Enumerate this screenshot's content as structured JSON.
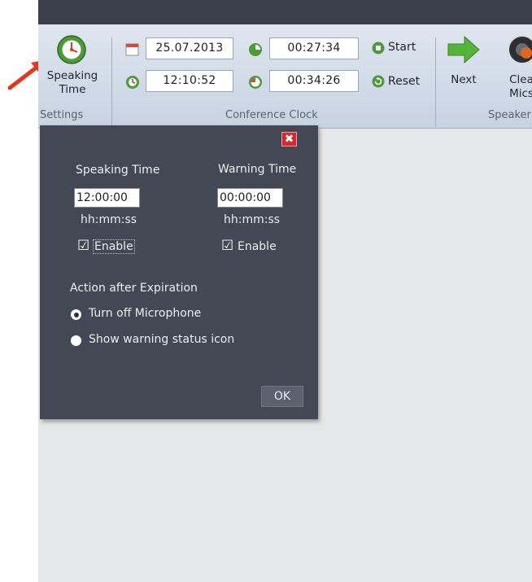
{
  "settings_group": {
    "speaking_time_label_line1": "Speaking",
    "speaking_time_label_line2": "Time",
    "group_label": "Settings"
  },
  "conference_clock": {
    "date": "25.07.2013",
    "time": "12:10:52",
    "elapsed": "00:27:34",
    "remaining": "00:34:26",
    "start_label": "Start",
    "reset_label": "Reset",
    "group_label": "Conference Clock"
  },
  "speaker_group": {
    "next_label": "Next",
    "clear_mics_line1": "Clea",
    "clear_mics_line2": "Mics",
    "group_label": "Speaker"
  },
  "dialog": {
    "close_glyph": "✖",
    "speaking_time_heading": "Speaking Time",
    "warning_time_heading": "Warning Time",
    "speaking_time_value": "12:00:00",
    "warning_time_value": "00:00:00",
    "format_hint_left": "hh:mm:ss",
    "format_hint_right": "hh:mm:ss",
    "enable_left_label": "Enable",
    "enable_right_label": "Enable",
    "enable_left_checked": true,
    "enable_right_checked": true,
    "action_heading": "Action after Expiration",
    "options": [
      {
        "label": "Turn off Microphone",
        "selected": true
      },
      {
        "label": "Show warning status icon",
        "selected": false
      }
    ],
    "ok_label": "OK"
  },
  "colors": {
    "titlebar": "#3a3f4c",
    "dialog_bg": "#444855",
    "close_red": "#d8262b",
    "arrow_red": "#e03a1e",
    "clock_green": "#4e9a3a"
  }
}
